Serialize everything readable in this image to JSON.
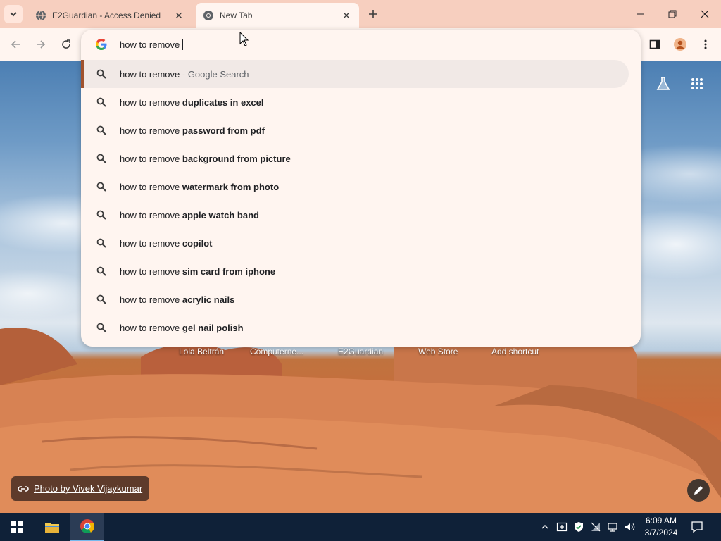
{
  "browser": {
    "tabs": [
      {
        "title": "E2Guardian - Access Denied",
        "active": false
      },
      {
        "title": "New Tab",
        "active": true
      }
    ]
  },
  "omnibox": {
    "input_value": "how to remove",
    "suggestions": [
      {
        "prefix": "how to remove",
        "bold": "",
        "suffix": " - Google Search",
        "selected": true
      },
      {
        "prefix": "how to remove",
        "bold": "duplicates in excel",
        "suffix": ""
      },
      {
        "prefix": "how to remove",
        "bold": "password from pdf",
        "suffix": ""
      },
      {
        "prefix": "how to remove",
        "bold": "background from picture",
        "suffix": ""
      },
      {
        "prefix": "how to remove",
        "bold": "watermark from photo",
        "suffix": ""
      },
      {
        "prefix": "how to remove",
        "bold": "apple watch band",
        "suffix": ""
      },
      {
        "prefix": "how to remove",
        "bold": "copilot",
        "suffix": ""
      },
      {
        "prefix": "how to remove",
        "bold": "sim card from iphone",
        "suffix": ""
      },
      {
        "prefix": "how to remove",
        "bold": "acrylic nails",
        "suffix": ""
      },
      {
        "prefix": "how to remove",
        "bold": "gel nail polish",
        "suffix": ""
      }
    ]
  },
  "ntp": {
    "shortcuts": [
      "Lola Beltrán",
      "Computerne...",
      "E2Guardian",
      "Web Store",
      "Add shortcut"
    ],
    "photo_credit": "Photo by Vivek Vijaykumar"
  },
  "taskbar": {
    "time": "6:09 AM",
    "date": "3/7/2024"
  },
  "colors": {
    "accent": "#a0522d",
    "frame": "#f7cfbf",
    "toolbar": "#fff5f0",
    "taskbar": "#0f2138"
  },
  "icons": {
    "tab_strip": [
      "tab-search-icon",
      "globe-icon",
      "chrome-icon",
      "close-icon",
      "plus-icon",
      "minimize-icon",
      "restore-icon",
      "window-close-icon"
    ],
    "toolbar": [
      "back-icon",
      "forward-icon",
      "reload-icon",
      "google-g-icon",
      "side-panel-icon",
      "profile-icon",
      "menu-icon"
    ],
    "ntp": [
      "labs-flask-icon",
      "apps-grid-icon",
      "link-icon",
      "pencil-icon"
    ],
    "taskbar": [
      "windows-start-icon",
      "file-explorer-icon",
      "chrome-icon",
      "chevron-up-icon",
      "tray-app-icon",
      "security-shield-icon",
      "network-icon",
      "volume-icon",
      "notification-icon"
    ]
  }
}
